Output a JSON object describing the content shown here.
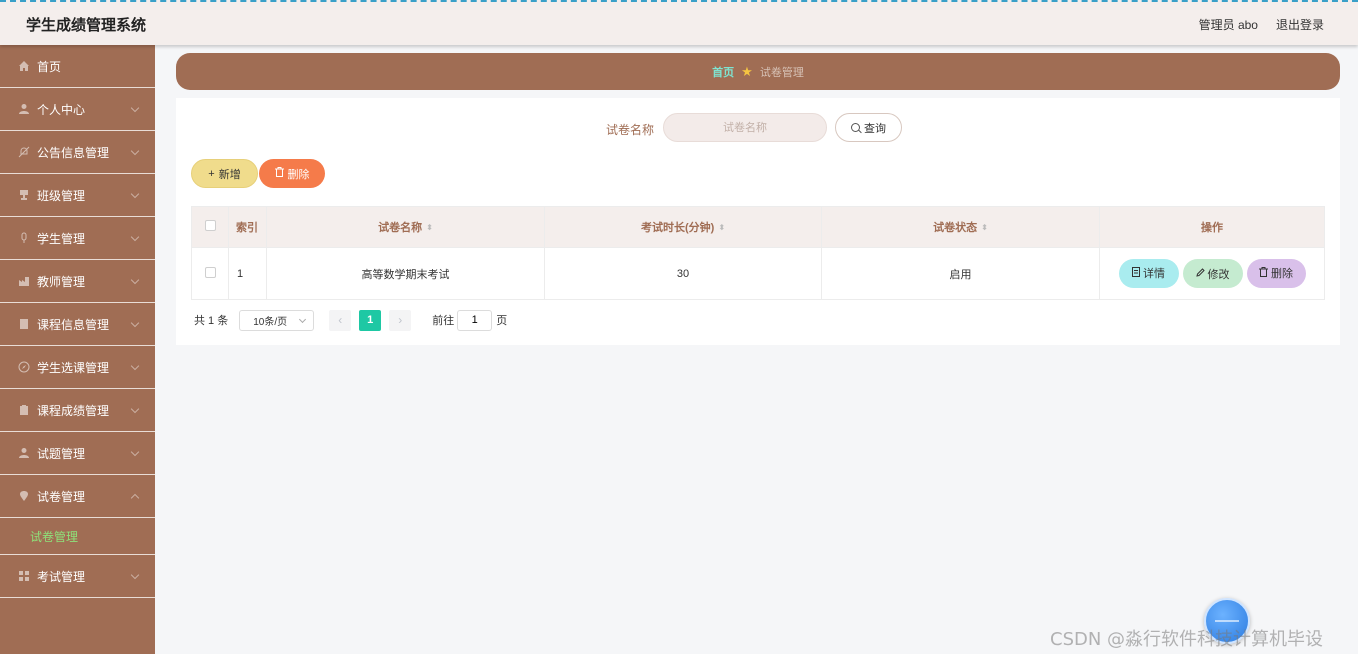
{
  "header": {
    "title": "学生成绩管理系统",
    "user_label": "管理员 abo",
    "logout": "退出登录"
  },
  "sidebar": {
    "items": [
      {
        "label": "首页",
        "icon": "home-icon",
        "expandable": false
      },
      {
        "label": "个人中心",
        "icon": "user-icon",
        "expandable": true
      },
      {
        "label": "公告信息管理",
        "icon": "bell-off-icon",
        "expandable": true
      },
      {
        "label": "班级管理",
        "icon": "trophy-icon",
        "expandable": true
      },
      {
        "label": "学生管理",
        "icon": "microphone-icon",
        "expandable": true
      },
      {
        "label": "教师管理",
        "icon": "factory-icon",
        "expandable": true
      },
      {
        "label": "课程信息管理",
        "icon": "document-icon",
        "expandable": true
      },
      {
        "label": "学生选课管理",
        "icon": "compass-icon",
        "expandable": true
      },
      {
        "label": "课程成绩管理",
        "icon": "clipboard-icon",
        "expandable": true
      },
      {
        "label": "试题管理",
        "icon": "user-icon",
        "expandable": true
      },
      {
        "label": "试卷管理",
        "icon": "location-icon",
        "expandable": true,
        "expanded": true,
        "sub": "试卷管理"
      },
      {
        "label": "考试管理",
        "icon": "grid-icon",
        "expandable": true
      }
    ]
  },
  "breadcrumb": {
    "home": "首页",
    "current": "试卷管理"
  },
  "search": {
    "label": "试卷名称",
    "placeholder": "试卷名称",
    "button": "查询"
  },
  "actions": {
    "add": "新增",
    "delete": "删除"
  },
  "table": {
    "columns": [
      "索引",
      "试卷名称",
      "考试时长(分钟)",
      "试卷状态",
      "操作"
    ],
    "rows": [
      {
        "index": "1",
        "name": "高等数学期末考试",
        "duration": "30",
        "status": "启用"
      }
    ],
    "row_actions": {
      "detail": "详情",
      "edit": "修改",
      "delete": "删除"
    }
  },
  "pagination": {
    "total": "共 1 条",
    "page_size": "10条/页",
    "current": "1",
    "goto_prefix": "前往",
    "goto_value": "1",
    "goto_suffix": "页"
  },
  "watermark": "CSDN @淼行软件科技计算机毕设"
}
